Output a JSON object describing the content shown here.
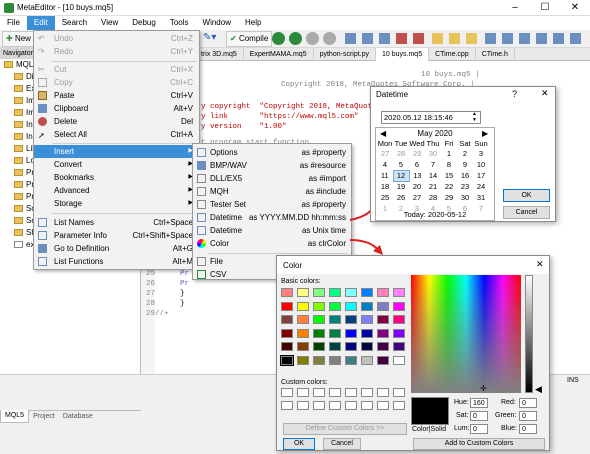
{
  "window": {
    "title": "MetaEditor - [10 buys.mq5]"
  },
  "menubar": [
    "File",
    "Edit",
    "Search",
    "View",
    "Debug",
    "Tools",
    "Window",
    "Help"
  ],
  "toolbar": {
    "new_label": "New",
    "compile_label": "Compile"
  },
  "navigator": {
    "header": "Navigator",
    "root": "MQL5",
    "items": [
      "Di",
      "Ex",
      "Im",
      "Im",
      "In",
      "In",
      "Lib",
      "Lo",
      "Pr",
      "Pr",
      "Pr",
      "Sc",
      "Sc",
      "Sh",
      "ex"
    ],
    "tabs": [
      "MQL5",
      "Project",
      "Database"
    ]
  },
  "file_tabs": [
    "trix 3D.mq5",
    "ExpertMAMA.mq5",
    "python-script.py",
    "10 buys.mq5",
    "CTime.cpp",
    "CTime.h"
  ],
  "editor": {
    "header_line1": "10 buys.mq5 |",
    "header_line2": "Copyright 2018, MetaQuotes Software Corp. |",
    "prop1": "y copyright  \"Copyright 2018, MetaQuote",
    "prop2": "y link       \"https://www.mql5.com\"",
    "prop3": "y version    \"1.00\"",
    "comment": "t program start function",
    "line_numbers": [
      "25",
      "26",
      "27",
      "28",
      "29"
    ],
    "l25": "  Pr",
    "l26": "  Pr",
    "l27": "  }",
    "l28": "  }",
    "l29": "//+"
  },
  "edit_menu": {
    "items": [
      {
        "label": "Undo",
        "shortcut": "Ctrl+Z",
        "disabled": true
      },
      {
        "label": "Redo",
        "shortcut": "Ctrl+Y",
        "disabled": true
      },
      {
        "label": "Cut",
        "shortcut": "Ctrl+X",
        "disabled": true
      },
      {
        "label": "Copy",
        "shortcut": "Ctrl+C",
        "disabled": true
      },
      {
        "label": "Paste",
        "shortcut": "Ctrl+V",
        "disabled": false
      },
      {
        "label": "Clipboard",
        "shortcut": "Alt+V",
        "disabled": false
      },
      {
        "label": "Delete",
        "shortcut": "Del",
        "disabled": false
      },
      {
        "label": "Select All",
        "shortcut": "Ctrl+A",
        "disabled": false
      },
      {
        "label": "Insert",
        "shortcut": "",
        "disabled": false
      },
      {
        "label": "Convert",
        "shortcut": "",
        "disabled": false
      },
      {
        "label": "Bookmarks",
        "shortcut": "",
        "disabled": false
      },
      {
        "label": "Advanced",
        "shortcut": "",
        "disabled": false
      },
      {
        "label": "Storage",
        "shortcut": "",
        "disabled": false
      },
      {
        "label": "List Names",
        "shortcut": "Ctrl+Space",
        "disabled": false
      },
      {
        "label": "Parameter Info",
        "shortcut": "Ctrl+Shift+Space",
        "disabled": false
      },
      {
        "label": "Go to Definition",
        "shortcut": "Alt+G",
        "disabled": false
      },
      {
        "label": "List Functions",
        "shortcut": "Alt+M",
        "disabled": false
      }
    ]
  },
  "insert_submenu": {
    "items": [
      {
        "label": "Options",
        "shortcut": "as #property"
      },
      {
        "label": "BMP/WAV",
        "shortcut": "as #resource"
      },
      {
        "label": "DLL/EX5",
        "shortcut": "as #import"
      },
      {
        "label": "MQH",
        "shortcut": "as #include"
      },
      {
        "label": "Tester Set",
        "shortcut": "as #property"
      },
      {
        "label": "Datetime",
        "shortcut": "as YYYY.MM.DD hh:mm:ss"
      },
      {
        "label": "Datetime",
        "shortcut": "as Unix time"
      },
      {
        "label": "Color",
        "shortcut": "as clrColor"
      },
      {
        "label": "File",
        "shortcut": ""
      },
      {
        "label": "CSV",
        "shortcut": ""
      }
    ]
  },
  "datetime_dialog": {
    "title": "Datetime",
    "help": "?",
    "value": "2020.05.12 18:15:46",
    "month": "May 2020",
    "weekdays": [
      "Mon",
      "Tue",
      "Wed",
      "Thu",
      "Fri",
      "Sat",
      "Sun"
    ],
    "weeks": [
      [
        "27",
        "28",
        "29",
        "30",
        "1",
        "2",
        "3"
      ],
      [
        "4",
        "5",
        "6",
        "7",
        "8",
        "9",
        "10"
      ],
      [
        "11",
        "12",
        "13",
        "14",
        "15",
        "16",
        "17"
      ],
      [
        "18",
        "19",
        "20",
        "21",
        "22",
        "23",
        "24"
      ],
      [
        "25",
        "26",
        "27",
        "28",
        "29",
        "30",
        "31"
      ],
      [
        "1",
        "2",
        "3",
        "4",
        "5",
        "6",
        "7"
      ]
    ],
    "today": "Today: 2020-05-12",
    "ok": "OK",
    "cancel": "Cancel"
  },
  "color_dialog": {
    "title": "Color",
    "basic_colors_label": "Basic colors:",
    "custom_colors_label": "Custom colors:",
    "define_button": "Define Custom Colors >>",
    "ok": "OK",
    "cancel": "Cancel",
    "add_button": "Add to Custom Colors",
    "color_solid": "Color|Solid",
    "hue_label": "Hue:",
    "hue": "160",
    "sat_label": "Sat:",
    "sat": "0",
    "lum_label": "Lum:",
    "lum": "0",
    "red_label": "Red:",
    "red": "0",
    "green_label": "Green:",
    "green": "0",
    "blue_label": "Blue:",
    "blue": "0",
    "basic_colors": [
      "#ff8080",
      "#ffff80",
      "#80ff80",
      "#00ff80",
      "#80ffff",
      "#0080ff",
      "#ff80c0",
      "#ff80ff",
      "#ff0000",
      "#ffff00",
      "#80ff00",
      "#00ff40",
      "#00ffff",
      "#0080c0",
      "#8080c0",
      "#ff00ff",
      "#804040",
      "#ff8040",
      "#00ff00",
      "#008080",
      "#004080",
      "#8080ff",
      "#800040",
      "#ff0080",
      "#800000",
      "#ff8000",
      "#008000",
      "#008040",
      "#0000ff",
      "#0000a0",
      "#800080",
      "#8000ff",
      "#400000",
      "#804000",
      "#004000",
      "#004040",
      "#000080",
      "#000040",
      "#400040",
      "#400080",
      "#000000",
      "#808000",
      "#808040",
      "#808080",
      "#408080",
      "#c0c0c0",
      "#400040",
      "#ffffff"
    ]
  },
  "statusbar": {
    "ins": "INS"
  }
}
